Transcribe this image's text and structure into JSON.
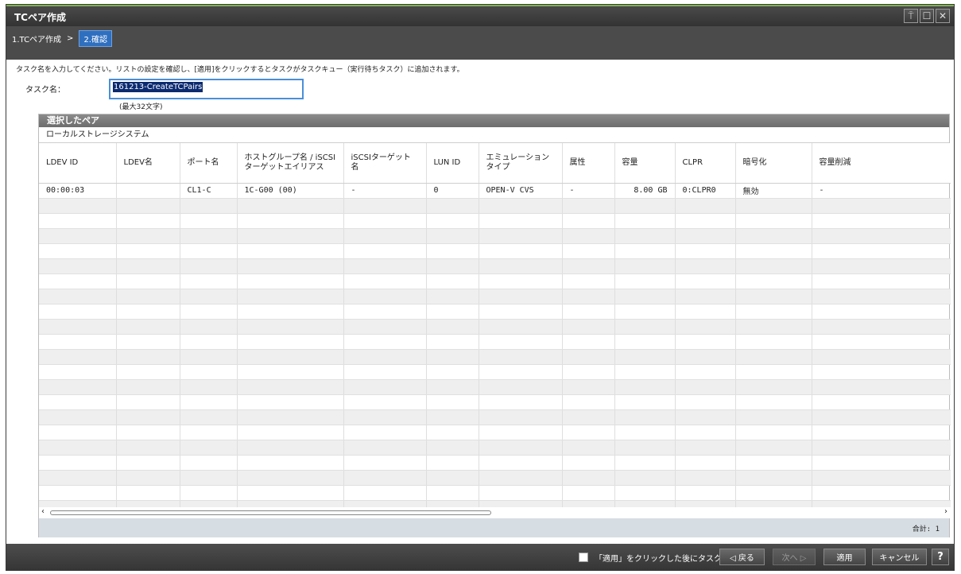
{
  "window": {
    "title": "TCペア作成",
    "controls": [
      "pin-icon",
      "maximize-icon",
      "close-icon"
    ]
  },
  "wizard": {
    "step1": "1.TCペア作成",
    "separator": ">",
    "step2": "2.確認"
  },
  "instructions": "タスク名を入力してください。リストの設定を確認し、[適用]をクリックするとタスクがタスクキュー（実行待ちタスク）に追加されます。",
  "task": {
    "label": "タスク名：",
    "value": "161213-CreateTCPairs",
    "hint": "(最大32文字)"
  },
  "panel": {
    "title": "選択したペア",
    "subheader": "ローカルストレージシステム",
    "columns": [
      "LDEV ID",
      "LDEV名",
      "ポート名",
      "ホストグループ名 / iSCSIターゲットエイリアス",
      "iSCSIターゲット名",
      "LUN ID",
      "エミュレーションタイプ",
      "属性",
      "容量",
      "CLPR",
      "暗号化",
      "容量削減"
    ],
    "rows": [
      [
        "00:00:03",
        "",
        "CL1-C",
        "1C-G00 (00)",
        "-",
        "0",
        "OPEN-V CVS",
        "-",
        "8.00 GB",
        "0:CLPR0",
        "無効",
        "-"
      ]
    ],
    "total": "合計: 1"
  },
  "footer": {
    "checkbox_label": "「適用」をクリックした後にタスク画面を表示",
    "back": "◁ 戻る",
    "next": "次へ ▷",
    "apply": "適用",
    "cancel": "キャンセル",
    "help": "?"
  }
}
